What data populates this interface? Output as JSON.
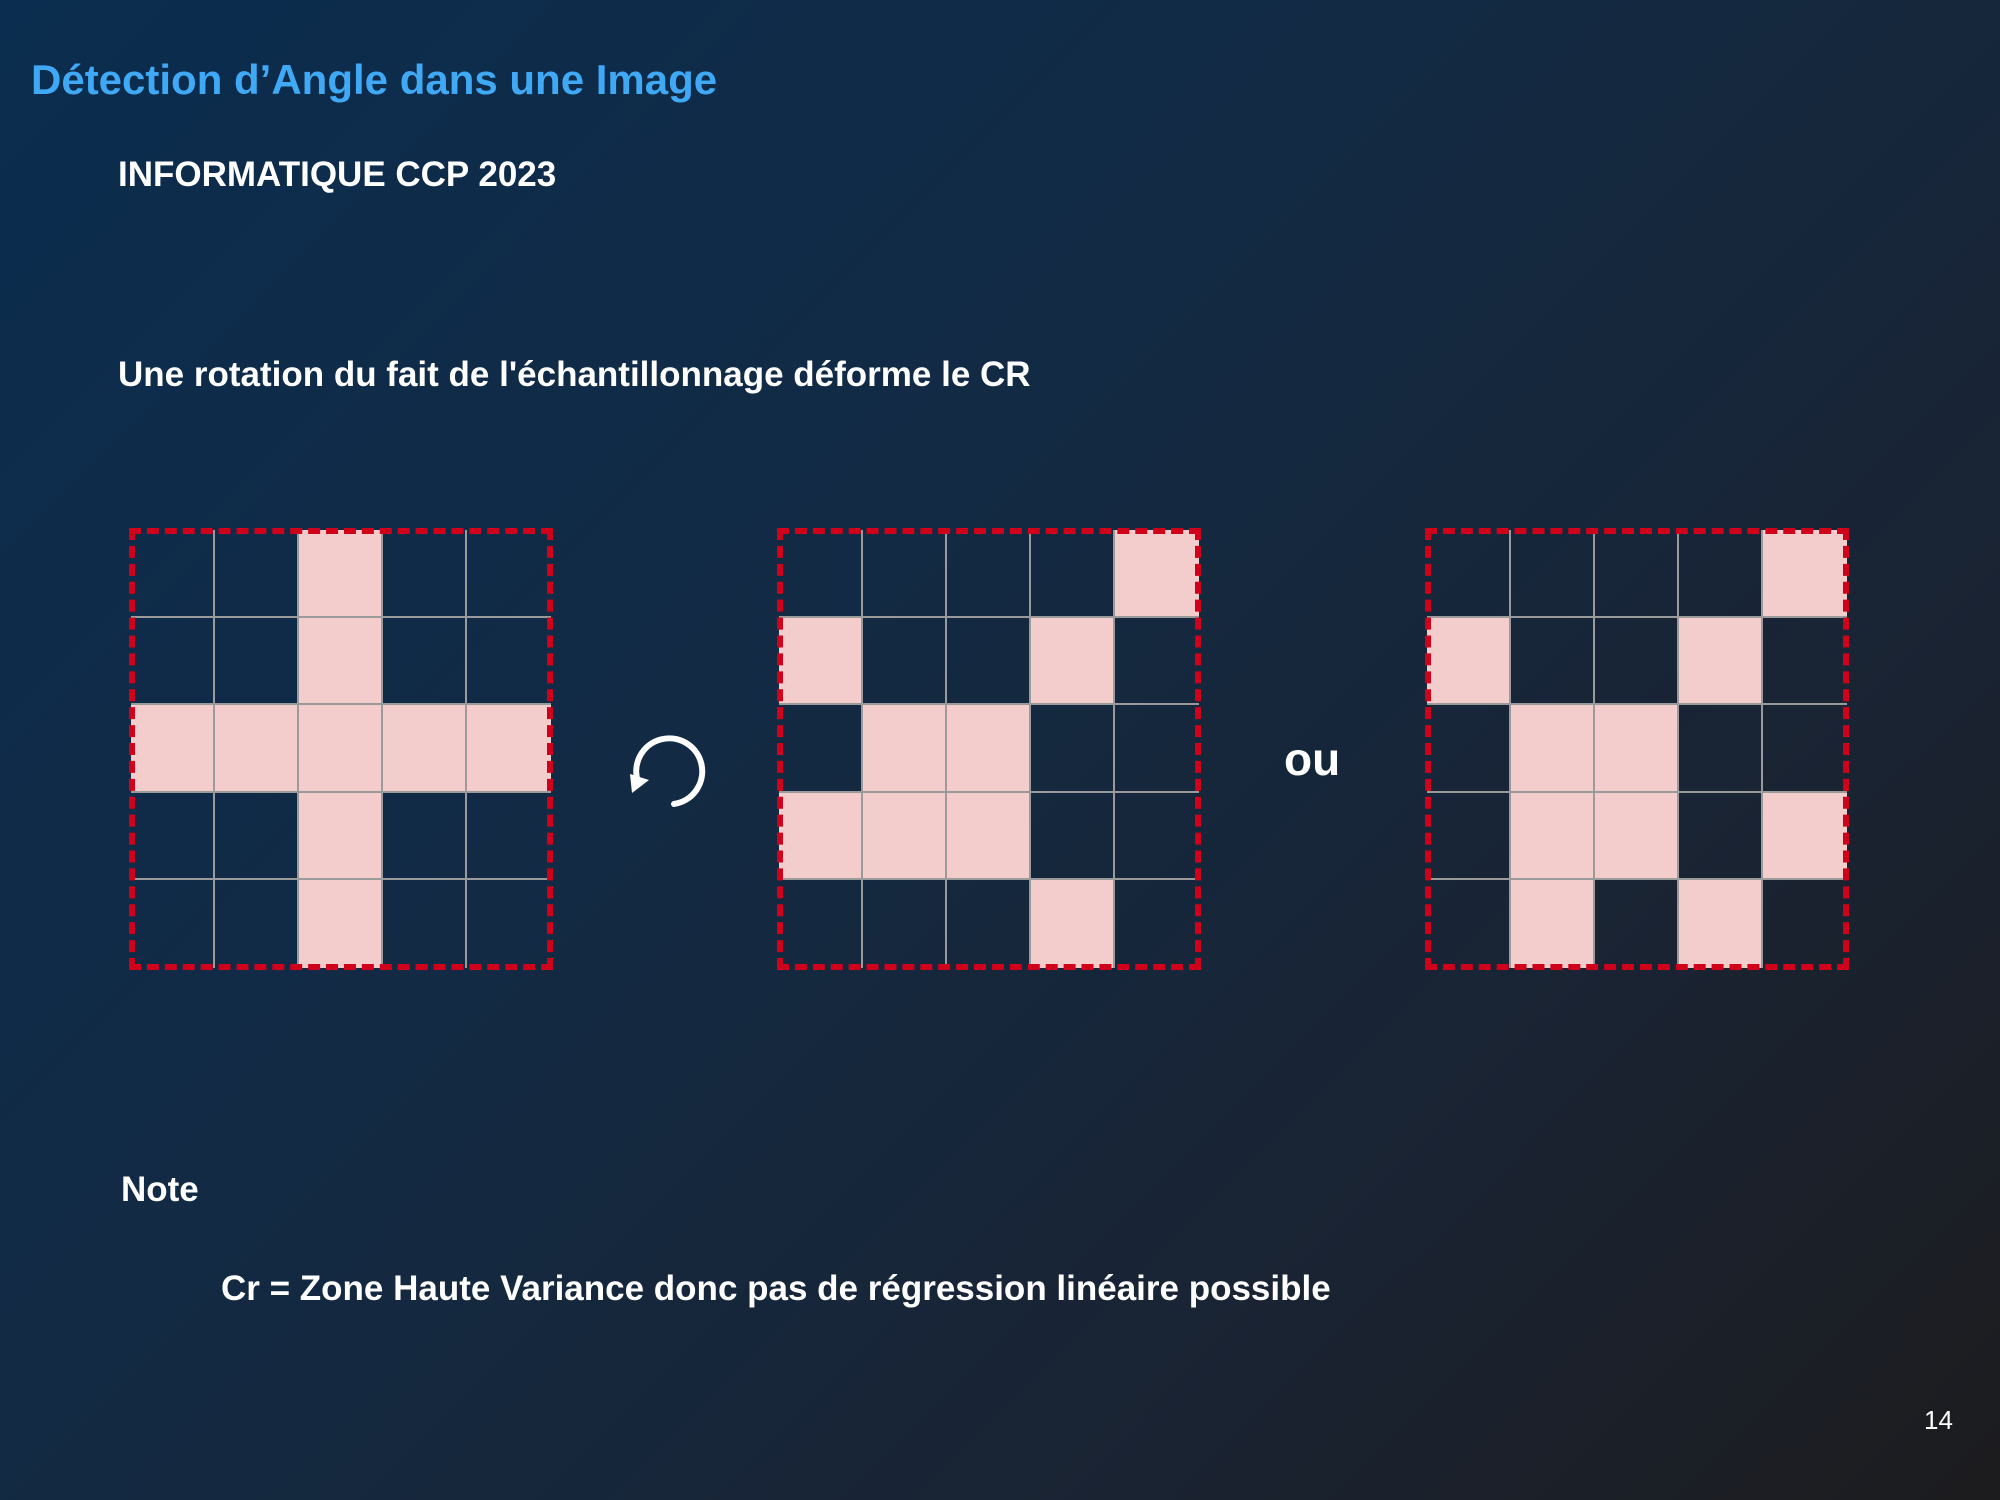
{
  "slide": {
    "title": "Détection d’Angle dans une Image",
    "subtitle": "INFORMATIQUE CCP 2023",
    "statement": "Une rotation du fait de l'échantillonnage déforme le CR",
    "or_label": "ou",
    "note_label": "Note",
    "note_text": "Cr = Zone Haute Variance donc pas de régression linéaire possible",
    "page_number": "14"
  },
  "diagram": {
    "grid_size": 5,
    "colors": {
      "filled_cell": "#f3cccc",
      "grid_line": "#9a9a9a",
      "frame_dash": "#d0021b",
      "title": "#3fa9f5"
    },
    "icons": {
      "rotation": "rotate-counterclockwise-icon"
    },
    "grids": [
      {
        "name": "original",
        "rows": [
          [
            0,
            0,
            1,
            0,
            0
          ],
          [
            0,
            0,
            1,
            0,
            0
          ],
          [
            1,
            1,
            1,
            1,
            1
          ],
          [
            0,
            0,
            1,
            0,
            0
          ],
          [
            0,
            0,
            1,
            0,
            0
          ]
        ]
      },
      {
        "name": "rotated-a",
        "rows": [
          [
            0,
            0,
            0,
            0,
            1
          ],
          [
            1,
            0,
            0,
            1,
            0
          ],
          [
            0,
            1,
            1,
            0,
            0
          ],
          [
            1,
            1,
            1,
            0,
            0
          ],
          [
            0,
            0,
            0,
            1,
            0
          ]
        ]
      },
      {
        "name": "rotated-b",
        "rows": [
          [
            0,
            0,
            0,
            0,
            1
          ],
          [
            1,
            0,
            0,
            1,
            0
          ],
          [
            0,
            1,
            1,
            0,
            0
          ],
          [
            0,
            1,
            1,
            0,
            1
          ],
          [
            0,
            1,
            0,
            1,
            0
          ]
        ]
      }
    ]
  }
}
